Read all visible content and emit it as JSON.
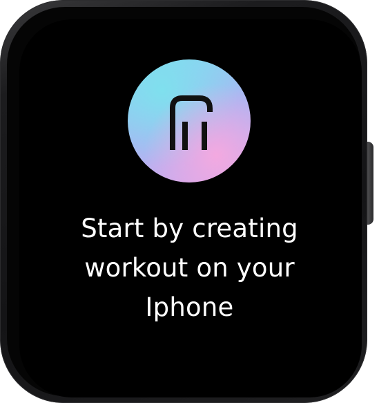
{
  "screen": {
    "message_lines": [
      "Start by creating",
      "workout on your",
      "Iphone"
    ]
  },
  "logo": {
    "icon": "fi-logo-icon",
    "gradient_colors": [
      "#80dcef",
      "#a9b6f3",
      "#f3a9e0"
    ]
  },
  "colors": {
    "screen_background": "#000000",
    "text": "#ffffff"
  }
}
